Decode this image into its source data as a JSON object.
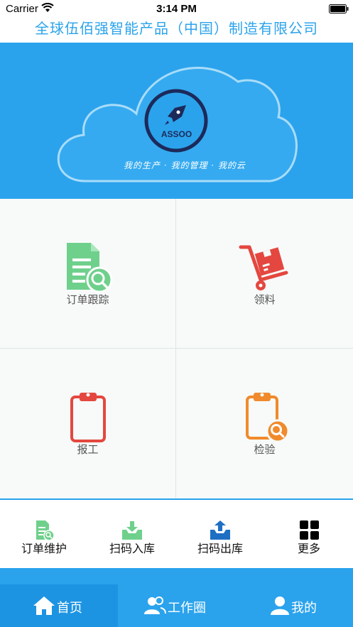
{
  "status_bar": {
    "carrier": "Carrier",
    "time": "3:14 PM"
  },
  "header": {
    "title": "全球伍佰强智能产品（中国）制造有限公司"
  },
  "banner": {
    "logo_text": "ASSOO",
    "slogan": "我的生产 · 我的管理 · 我的云"
  },
  "grid": {
    "items": [
      {
        "label": "订单跟踪",
        "icon": "document-search-icon"
      },
      {
        "label": "领料",
        "icon": "hand-truck-icon"
      },
      {
        "label": "报工",
        "icon": "clipboard-icon"
      },
      {
        "label": "检验",
        "icon": "clipboard-search-icon"
      }
    ]
  },
  "quick_actions": {
    "items": [
      {
        "label": "订单维护",
        "icon": "document-search-icon"
      },
      {
        "label": "扫码入库",
        "icon": "inbox-download-icon"
      },
      {
        "label": "扫码出库",
        "icon": "inbox-upload-icon"
      },
      {
        "label": "更多",
        "icon": "grid-icon"
      }
    ]
  },
  "tabs": [
    {
      "label": "首页",
      "icon": "home-icon",
      "active": true
    },
    {
      "label": "工作圈",
      "icon": "users-icon",
      "active": false
    },
    {
      "label": "我的",
      "icon": "user-icon",
      "active": false
    }
  ],
  "colors": {
    "primary": "#2ba3ec",
    "green": "#6fd08c",
    "red": "#e4473f",
    "orange": "#f08a2c",
    "navy": "#1c2a5a"
  }
}
